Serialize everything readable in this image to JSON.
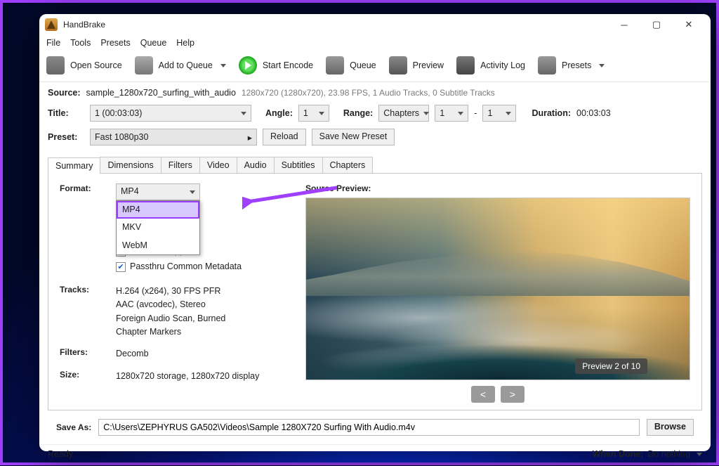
{
  "window": {
    "title": "HandBrake"
  },
  "menu": {
    "file": "File",
    "tools": "Tools",
    "presets": "Presets",
    "queue": "Queue",
    "help": "Help"
  },
  "toolbar": {
    "open": "Open Source",
    "add": "Add to Queue",
    "start": "Start Encode",
    "queue": "Queue",
    "preview": "Preview",
    "log": "Activity Log",
    "presets": "Presets"
  },
  "source": {
    "label": "Source:",
    "file": "sample_1280x720_surfing_with_audio",
    "meta": "1280x720 (1280x720), 23.98 FPS, 1 Audio Tracks, 0 Subtitle Tracks"
  },
  "title_row": {
    "title_label": "Title:",
    "title_value": "1  (00:03:03)",
    "angle_label": "Angle:",
    "angle_value": "1",
    "range_label": "Range:",
    "range_mode": "Chapters",
    "range_from": "1",
    "range_dash": "-",
    "range_to": "1",
    "duration_label": "Duration:",
    "duration_value": "00:03:03"
  },
  "preset_row": {
    "label": "Preset:",
    "value": "Fast 1080p30",
    "reload": "Reload",
    "savenew": "Save New Preset"
  },
  "tabs": [
    "Summary",
    "Dimensions",
    "Filters",
    "Video",
    "Audio",
    "Subtitles",
    "Chapters"
  ],
  "summary": {
    "format_label": "Format:",
    "format_value": "MP4",
    "format_options": [
      "MP4",
      "MKV",
      "WebM"
    ],
    "ipod": "iPod 5G Support",
    "passthru": "Passthru Common Metadata",
    "tracks_label": "Tracks:",
    "tracks": [
      "H.264 (x264), 30 FPS PFR",
      "AAC (avcodec), Stereo",
      "Foreign Audio Scan, Burned",
      "Chapter Markers"
    ],
    "filters_label": "Filters:",
    "filters_value": "Decomb",
    "size_label": "Size:",
    "size_value": "1280x720 storage, 1280x720 display"
  },
  "preview": {
    "heading": "Source Preview:",
    "badge": "Preview 2 of 10",
    "prev": "<",
    "next": ">"
  },
  "saveas": {
    "label": "Save As:",
    "path": "C:\\Users\\ZEPHYRUS GA502\\Videos\\Sample 1280X720 Surfing With Audio.m4v",
    "browse": "Browse"
  },
  "status": {
    "ready": "Ready",
    "whendone_label": "When Done:",
    "whendone_value": "Do nothing"
  }
}
